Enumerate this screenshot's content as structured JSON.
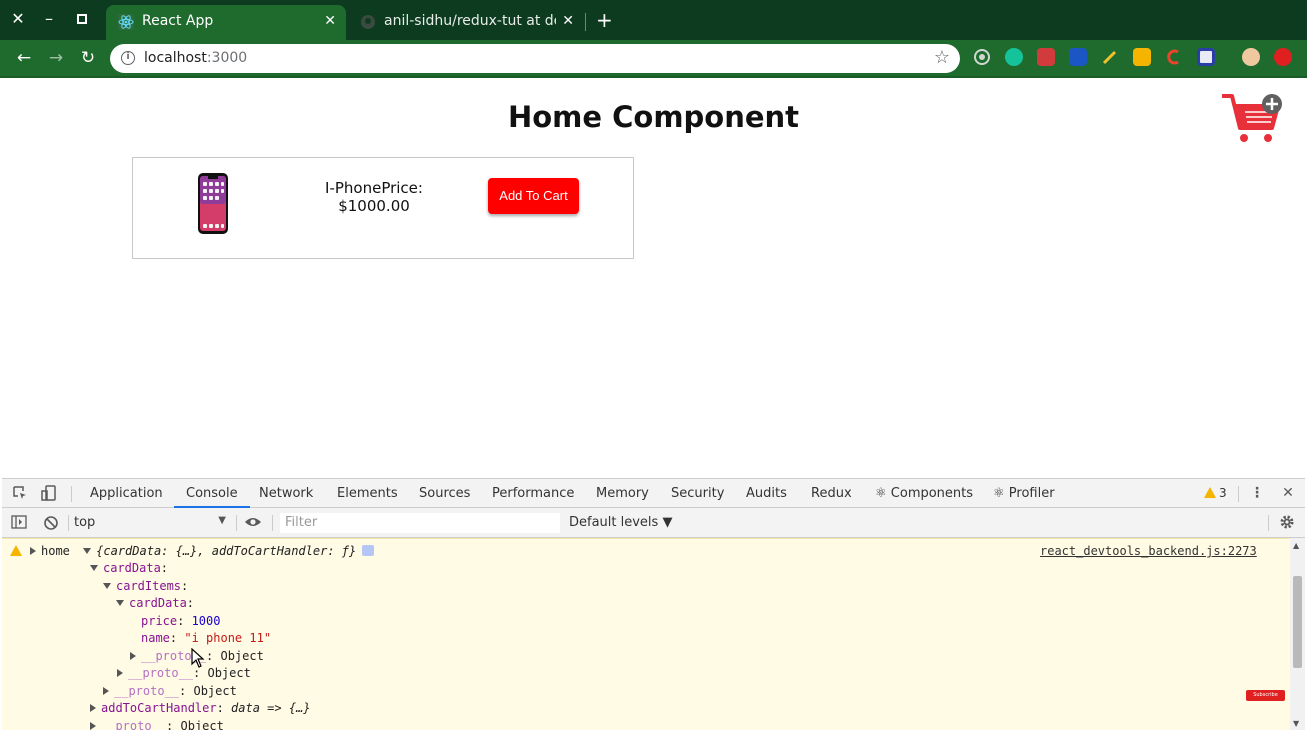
{
  "browser": {
    "tabs": [
      {
        "title": "React App",
        "active": true
      },
      {
        "title": "anil-sidhu/redux-tut at de",
        "active": false
      }
    ],
    "url": {
      "host": "localhost",
      "port": ":3000"
    },
    "colors": {
      "frame": "#0c3b1f",
      "toolbar": "#1f6b2e"
    }
  },
  "page": {
    "title": "Home Component",
    "product": {
      "line1": "I-PhonePrice:",
      "line2": "$1000.00"
    },
    "add_to_cart_label": "Add To Cart"
  },
  "devtools": {
    "tabs": [
      "Application",
      "Console",
      "Network",
      "Elements",
      "Sources",
      "Performance",
      "Memory",
      "Security",
      "Audits",
      "Redux",
      "⚛ Components",
      "⚛ Profiler"
    ],
    "active_tab": "Console",
    "warning_count": "3",
    "context": "top",
    "filter_placeholder": "Filter",
    "levels": "Default levels ▼",
    "console": {
      "source_link": "react_devtools_backend.js:2273",
      "log_label": "home",
      "log_summary": "{cardData: {…}, addToCartHandler: ƒ}",
      "lines": [
        {
          "key": "cardData",
          "sep": ":",
          "value": ""
        },
        {
          "key": "cardItems",
          "sep": ":",
          "value": ""
        },
        {
          "key": "cardData",
          "sep": ":",
          "value": ""
        },
        {
          "key": "price",
          "sep": ": ",
          "value": "1000"
        },
        {
          "key": "name",
          "sep": ": ",
          "value": "\"i phone 11\""
        },
        {
          "key": "__proto__",
          "sep": ": ",
          "value": "Object"
        },
        {
          "key": "__proto__",
          "sep": ": ",
          "value": "Object"
        },
        {
          "key": "__proto__",
          "sep": ": ",
          "value": "Object"
        },
        {
          "key": "addToCartHandler",
          "sep": ": ",
          "value": "data => {…}"
        },
        {
          "key": "__proto__",
          "sep": ": ",
          "value": "Object"
        }
      ]
    }
  },
  "overlay": {
    "subscribe_label": "Subscribe"
  }
}
